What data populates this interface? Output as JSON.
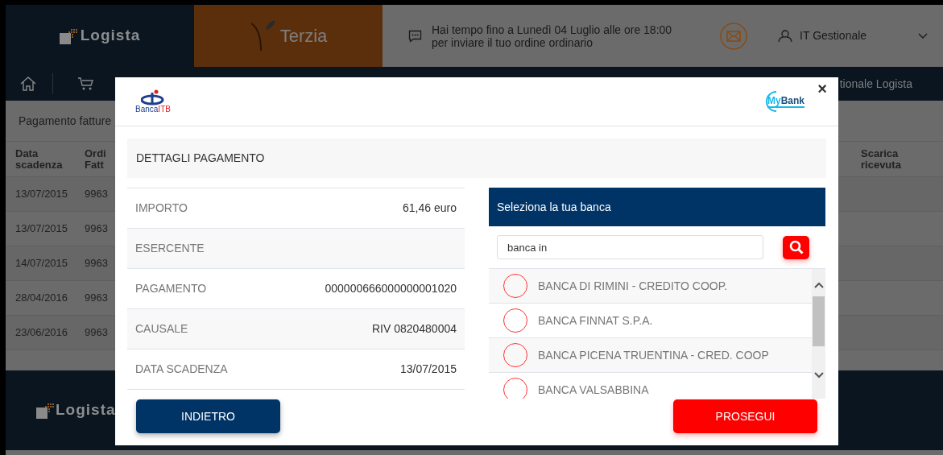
{
  "header": {
    "logo": "Logista",
    "partner_logo": "Terzia",
    "message_lines": [
      "Hai tempo fino a Lunedì 04 Luglio alle ore 18:00",
      "per inviare il tuo ordine ordinario"
    ],
    "user": "IT Gestionale"
  },
  "nav": {
    "trailing_text": "tionale Logista"
  },
  "page": {
    "title": "Pagamento fatture",
    "columns": [
      "Data scadenza",
      "Ordi Fatt",
      "Scarica ricevuta"
    ],
    "rows": [
      {
        "date": "13/07/2015",
        "order": "9963"
      },
      {
        "date": "13/07/2015",
        "order": "9963"
      },
      {
        "date": "14/07/2015",
        "order": "9963"
      },
      {
        "date": "28/04/2016",
        "order": "9963"
      },
      {
        "date": "23/06/2016",
        "order": "9963"
      }
    ]
  },
  "footer": {
    "logo": "Logista"
  },
  "modal": {
    "bank_logo": {
      "name": "Banca",
      "accent": "ITB"
    },
    "mybank_logo": {
      "my": "My",
      "bank": "Bank"
    },
    "close": "×",
    "section_title": "DETTAGLI PAGAMENTO",
    "details": [
      {
        "label": "IMPORTO",
        "value": "61,46 euro"
      },
      {
        "label": "ESERCENTE"
      },
      {
        "label": "PAGAMENTO",
        "value": "000000666000000001020"
      },
      {
        "label": "CAUSALE",
        "value": "RIV 0820480004"
      },
      {
        "label": "DATA SCADENZA",
        "value": "13/07/2015"
      }
    ],
    "bank_picker": {
      "title": "Seleziona la tua banca",
      "search_value": "banca in",
      "banks": [
        {
          "name": "BANCA DI RIMINI - CREDITO COOP.",
          "selected": false
        },
        {
          "name": "BANCA FINNAT S.P.A.",
          "selected": false
        },
        {
          "name": "BANCA PICENA TRUENTINA - CRED. COOP",
          "selected": false
        },
        {
          "name": "BANCA VALSABBINA",
          "selected": false
        }
      ]
    },
    "buttons": [
      {
        "label": "INDIETRO",
        "kind": "back"
      },
      {
        "label": "PROSEGUI",
        "kind": "next"
      }
    ]
  }
}
